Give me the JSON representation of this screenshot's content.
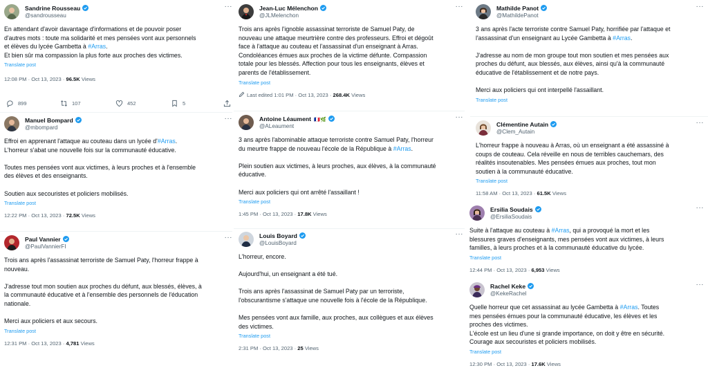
{
  "tweets": {
    "rousseau": {
      "name": "Sandrine Rousseau",
      "handle": "@sandrousseau",
      "text_a": "En attendant d'avoir davantage d'informations et de pouvoir poser\nd'autres mots : toute ma solidarité et mes pensées vont aux personnels\net élèves du lycée Gambetta à ",
      "hashtag": "#Arras",
      "text_b": ".\nEt bien sûr ma compassion la plus forte aux proches des victimes.",
      "translate": "Translate post",
      "time": "12:08 PM · Oct 13, 2023 · ",
      "views": "96.5K",
      "views_label": " Views",
      "replies": "899",
      "retweets": "107",
      "likes": "452",
      "bookmarks": "5"
    },
    "melenchon": {
      "name": "Jean-Luc Mélenchon",
      "handle": "@JLMelenchon",
      "text": "Trois ans après l'ignoble assassinat terroriste de Samuel Paty, de\nnouveau une attaque meurtrière contre des professeurs. Effroi et dégoût\nface à l'attaque au couteau et l'assassinat d'un enseignant à Arras.\nCondoléances émues aux proches de la victime défunte. Compassion\ntotale pour les blessés. Affection pour tous les enseignants, élèves et\nparents de l'établissement.",
      "translate": "Translate post",
      "time": "Last edited 1:01 PM · Oct 13, 2023 · ",
      "views": "268.4K",
      "views_label": " Views"
    },
    "panot": {
      "name": "Mathilde Panot",
      "handle": "@MathildePanot",
      "text_a": "3 ans après l'acte terroriste contre Samuel Paty, horrifiée par l'attaque et\nl'assassinat d'un enseignant au Lycée Gambetta à ",
      "hashtag": "#Arras",
      "text_b": ".\n\nJ'adresse au nom de mon groupe tout mon soutien et mes pensées aux\nproches du défunt, aux blessés, aux élèves, ainsi qu'à la communauté\néducative de l'établissement et de notre pays.\n\nMerci aux policiers qui ont interpellé l'assaillant.",
      "translate": "Translate post"
    },
    "bompard": {
      "name": "Manuel Bompard",
      "handle": "@mbompard",
      "text_a": "Effroi en apprenant l'attaque au couteau dans un lycée d'",
      "hashtag": "#Arras",
      "text_b": ".\nL'horreur s'abat une nouvelle fois sur la communauté éducative.\n\nToutes mes pensées vont aux victimes, à leurs proches et à l'ensemble\ndes élèves et des enseignants.\n\nSoutien aux secouristes et policiers mobilisés.",
      "translate": "Translate post",
      "time": "12:22 PM · Oct 13, 2023 · ",
      "views": "72.5K",
      "views_label": " Views"
    },
    "leaument": {
      "name": "Antoine Léaument",
      "handle": "@ALeaument",
      "text_a": "3 ans après l'abominable attaque terroriste contre Samuel Paty, l'horreur\ndu meurtre frappe de nouveau l'école de la République à ",
      "hashtag": "#Arras",
      "text_b": ".\n\nPlein soutien aux victimes, à leurs proches, aux élèves, à la communauté\néducative.\n\nMerci aux policiers qui ont arrêté l'assaillant !",
      "translate": "Translate post",
      "time": "1:45 PM · Oct 13, 2023 · ",
      "views": "17.8K",
      "views_label": " Views"
    },
    "autain": {
      "name": "Clémentine Autain",
      "handle": "@Clem_Autain",
      "text": "L'horreur frappe à nouveau à Arras, où un enseignant a été assassiné à\ncoups de couteau. Cela réveille en nous de terribles cauchemars, des\nréalités insoutenables. Mes pensées émues aux proches, tout mon\nsoutien à la communauté éducative.",
      "translate": "Translate post",
      "time": "11:58 AM · Oct 13, 2023 · ",
      "views": "61.5K",
      "views_label": " Views"
    },
    "vannier": {
      "name": "Paul Vannier",
      "handle": "@PaulVannierFI",
      "text": "Trois ans après l'assassinat terroriste de Samuel Paty, l'horreur frappe à\nnouveau.\n\nJ'adresse tout mon soutien aux proches du défunt, aux blessés, élèves, à\nla communauté éducative et à l'ensemble des personnels de l'éducation\nnationale.\n\nMerci aux policiers et aux secours.",
      "translate": "Translate post",
      "time": "12:31 PM · Oct 13, 2023 · ",
      "views": "4,781",
      "views_label": " Views"
    },
    "boyard": {
      "name": "Louis Boyard",
      "handle": "@LouisBoyard",
      "text": "L'horreur, encore.\n\nAujourd'hui, un enseignant a été tué.\n\nTrois ans après l'assassinat de Samuel Paty par un terroriste,\nl'obscurantisme s'attaque une nouvelle fois à l'école de la République.\n\nMes pensées vont aux famille, aux proches, aux collègues et aux élèves\ndes victimes.",
      "translate": "Translate post",
      "time": "2:31 PM · Oct 13, 2023 · ",
      "views": "25",
      "views_label": " Views"
    },
    "soudais": {
      "name": "Ersilia Soudais",
      "handle": "@ErsiliaSoudais",
      "text_a": "Suite à l'attaque au couteau à ",
      "hashtag": "#Arras",
      "text_b": ", qui a provoqué la mort et les\nblessures graves d'enseignants, mes pensées vont aux victimes, à leurs\nfamilles, à leurs proches et à la communauté éducative du lycée.",
      "translate": "Translate post",
      "time": "12:44 PM · Oct 13, 2023 · ",
      "views": "6,953",
      "views_label": " Views"
    },
    "keke": {
      "name": "Rachel Keke",
      "handle": "@KekeRachel",
      "text_a": "Quelle horreur que cet assassinat au lycée Gambetta à ",
      "hashtag": "#Arras",
      "text_b": ". Toutes\nmes pensées émues pour la communauté éducative, les élèves et les\nproches des victimes.\nL'école est un lieu d'une si grande importance, on doit y être en sécurité.\nCourage aux secouristes et policiers mobilisés.",
      "translate": "Translate post",
      "time": "12:30 PM · Oct 13, 2023 · ",
      "views": "17.6K",
      "views_label": " Views"
    }
  },
  "more_glyph": "···",
  "flags": "🇫🇷🌿",
  "colors": {
    "link": "#1d9bf0",
    "text": "#0f1419",
    "muted": "#536471",
    "verified": "#1d9bf0"
  },
  "icons": [
    "verified-badge-icon",
    "more-icon",
    "reply-icon",
    "retweet-icon",
    "like-icon",
    "bookmark-icon",
    "share-icon",
    "pencil-icon"
  ]
}
